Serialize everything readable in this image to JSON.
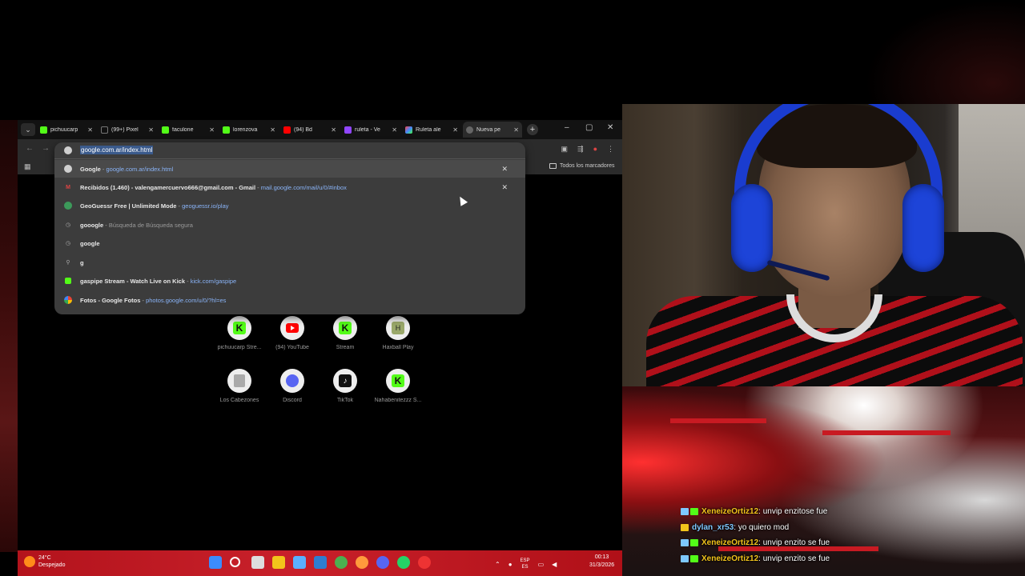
{
  "colors": {
    "kick_green": "#53fc18",
    "taskbar_red": "#c8202a",
    "chat_user_gold": "#f2c41b",
    "chat_user_blue": "#7ec8ff",
    "selection_blue": "#3a5a8c"
  },
  "browser": {
    "tabs": [
      {
        "icon": "kick-icon",
        "title": "pichuucarp"
      },
      {
        "icon": "tiktok-icon",
        "title": "(99+) Pixel"
      },
      {
        "icon": "kick-icon",
        "title": "faculone"
      },
      {
        "icon": "kick-icon",
        "title": "lorenzova"
      },
      {
        "icon": "youtube-icon",
        "title": "(94) Bd"
      },
      {
        "icon": "twitch-icon",
        "title": "ruleta - Ve"
      },
      {
        "icon": "ruleta-icon",
        "title": "Ruleta ale"
      },
      {
        "icon": "globe-icon",
        "title": "Nueva pe"
      }
    ],
    "new_tab": "+",
    "window_controls": {
      "minimize": "–",
      "maximize": "▢",
      "close": "✕"
    },
    "bookmarks_all": "Todos los marcadores",
    "omnibox": {
      "input_value": "google.com.ar/index.html",
      "suggestions": [
        {
          "icon": "google",
          "title": "Google",
          "sep": " - ",
          "url": "google.com.ar/index.html",
          "removable": true
        },
        {
          "icon": "gmail",
          "title": "Recibidos (1.460) - valengamercuervo666@gmail.com - Gmail",
          "sep": " - ",
          "url": "mail.google.com/mail/u/0/#inbox",
          "removable": true
        },
        {
          "icon": "geoguessr",
          "title": "GeoGuessr Free | Unlimited Mode",
          "sep": " - ",
          "url": "geoguessr.io/play"
        },
        {
          "icon": "history",
          "title": "gooogle",
          "sep": " - ",
          "gray": "Búsqueda de Búsqueda segura"
        },
        {
          "icon": "history",
          "title": "google"
        },
        {
          "icon": "search",
          "title": "g"
        },
        {
          "icon": "kick",
          "title": "gaspipe Stream - Watch Live on Kick",
          "sep": " - ",
          "url": "kick.com/gaspipe"
        },
        {
          "icon": "fotos",
          "title": "Fotos - Google Fotos",
          "sep": " - ",
          "url": "photos.google.com/u/0/?hl=es"
        }
      ]
    },
    "shortcuts": [
      {
        "label": "pichuucarp Stre...",
        "icon": "kick"
      },
      {
        "label": "(94) YouTube",
        "icon": "youtube"
      },
      {
        "label": "Stream",
        "icon": "kick"
      },
      {
        "label": "Haxball Play",
        "icon": "haxball"
      },
      {
        "label": "Los Cabezones",
        "icon": "cabezones"
      },
      {
        "label": "Discord",
        "icon": "discord"
      },
      {
        "label": "TikTok",
        "icon": "tiktok"
      },
      {
        "label": "Nahabenitezzz S...",
        "icon": "kick"
      }
    ]
  },
  "taskbar": {
    "weather_temp": "24°C",
    "weather_desc": "Despejado",
    "lang_top": "ESP",
    "lang_bottom": "ES",
    "time": "00:13",
    "date": "31/3/2026"
  },
  "chat": [
    {
      "user": "XeneizeOrtiz12",
      "color": "#f2c41b",
      "badges": "two",
      "msg": ": unvip enzitose fue"
    },
    {
      "user": "dylan_xr53",
      "color": "#7ec8ff",
      "badges": "one",
      "msg": ": yo quiero mod"
    },
    {
      "user": "XeneizeOrtiz12",
      "color": "#f2c41b",
      "badges": "two",
      "msg": ": unvip enzito se fue"
    },
    {
      "user": "XeneizeOrtiz12",
      "color": "#f2c41b",
      "badges": "two",
      "msg": ": unvip enzito se fue"
    }
  ]
}
